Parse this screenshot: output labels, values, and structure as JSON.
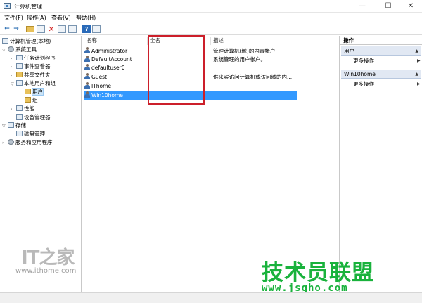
{
  "window": {
    "title": "计算机管理",
    "minimize": "—",
    "maximize": "☐",
    "close": "✕"
  },
  "menu": [
    "文件(F)",
    "操作(A)",
    "查看(V)",
    "帮助(H)"
  ],
  "toolbar": {
    "back": "←",
    "forward": "→",
    "delete": "✕",
    "help": "?"
  },
  "tree": {
    "root": "计算机管理(本地)",
    "system_tools": "系统工具",
    "task_scheduler": "任务计划程序",
    "event_viewer": "事件查看器",
    "shared_folders": "共享文件夹",
    "local_users_groups": "本地用户和组",
    "users": "用户",
    "groups": "组",
    "performance": "性能",
    "device_manager": "设备管理器",
    "storage": "存储",
    "disk_management": "磁盘管理",
    "services_apps": "服务和应用程序"
  },
  "list": {
    "columns": [
      "名称",
      "全名",
      "描述"
    ],
    "rows": [
      {
        "name": "Administrator",
        "full_name": "",
        "description": "管理计算机(域)的内置帐户"
      },
      {
        "name": "DefaultAccount",
        "full_name": "",
        "description": "系统管理的用户帐户。"
      },
      {
        "name": "defaultuser0",
        "full_name": "",
        "description": ""
      },
      {
        "name": "Guest",
        "full_name": "",
        "description": "供来宾访问计算机或访问域的内..."
      },
      {
        "name": "IThome",
        "full_name": "",
        "description": ""
      },
      {
        "name": "Win10home",
        "full_name": "",
        "description": ""
      }
    ],
    "selected_row": "Win10home"
  },
  "actions": {
    "title": "操作",
    "groups": [
      {
        "label": "用户",
        "item": "更多操作"
      },
      {
        "label": "Win10home",
        "item": "更多操作"
      }
    ]
  },
  "watermarks": {
    "ithome_logo": "IT之家",
    "ithome_site": "www.ithome.com",
    "jsgho_logo": "技术员联盟",
    "jsgho_site": "www.jsgho.com"
  },
  "colors": {
    "selection": "#3399ff",
    "annotation": "#cc1f2a",
    "watermark_green": "#19b23c"
  }
}
